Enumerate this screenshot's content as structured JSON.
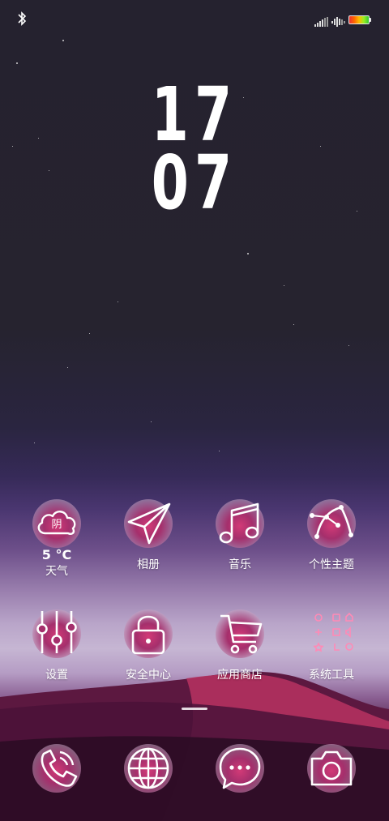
{
  "status_bar": {
    "icons": [
      "bluetooth-icon",
      "signal-strength-icon",
      "signal-strength-icon",
      "battery-icon"
    ]
  },
  "clock": {
    "hours": "17",
    "minutes": "07"
  },
  "weather": {
    "condition": "阴",
    "temperature": "5 °C",
    "label": "天气"
  },
  "apps_row1": [
    {
      "label": "天气",
      "icon": "cloud-icon"
    },
    {
      "label": "相册",
      "icon": "paper-plane-icon"
    },
    {
      "label": "音乐",
      "icon": "music-note-icon"
    },
    {
      "label": "个性主题",
      "icon": "bezier-curve-icon"
    }
  ],
  "apps_row2": [
    {
      "label": "设置",
      "icon": "sliders-icon"
    },
    {
      "label": "安全中心",
      "icon": "lock-icon"
    },
    {
      "label": "应用商店",
      "icon": "shopping-cart-icon"
    },
    {
      "label": "系统工具",
      "icon": "folder-grid-icon"
    }
  ],
  "dock": [
    {
      "icon": "phone-icon"
    },
    {
      "icon": "globe-icon"
    },
    {
      "icon": "message-icon"
    },
    {
      "icon": "camera-icon"
    }
  ],
  "colors": {
    "icon_glow": "#d23a77",
    "sky": "#25222f",
    "dune": "#6b1a45"
  }
}
